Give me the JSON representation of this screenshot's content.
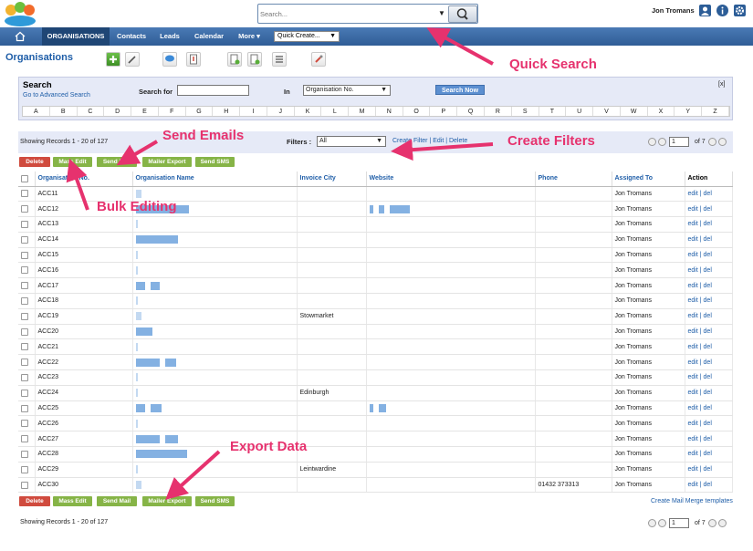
{
  "header": {
    "search_placeholder": "Search...",
    "user_name": "Jon Tromans",
    "icons": [
      "user-icon",
      "info-icon",
      "gear-icon"
    ]
  },
  "nav": {
    "home_icon": "home-icon",
    "tabs": [
      {
        "label": "ORGANISATIONS",
        "active": true
      },
      {
        "label": "Contacts"
      },
      {
        "label": "Leads"
      },
      {
        "label": "Calendar"
      },
      {
        "label": "More ▾"
      }
    ],
    "quick_create": "Quick Create..."
  },
  "page": {
    "title": "Organisations",
    "toolbar_icons": [
      "add-icon",
      "edit-icon",
      "chat-icon",
      "import-icon",
      "export-icon",
      "export-alt-icon",
      "merge-icon",
      "tools-icon"
    ]
  },
  "search": {
    "title": "Search",
    "advanced_link": "Go to Advanced Search",
    "search_for_label": "Search for",
    "in_label": "In",
    "in_value": "Organisation No.",
    "search_now": "Search Now",
    "close": "[x]",
    "alphabet": [
      "A",
      "B",
      "C",
      "D",
      "E",
      "F",
      "G",
      "H",
      "I",
      "J",
      "K",
      "L",
      "M",
      "N",
      "O",
      "P",
      "Q",
      "R",
      "S",
      "T",
      "U",
      "V",
      "W",
      "X",
      "Y",
      "Z"
    ]
  },
  "listing": {
    "showing_text": "Showing Records 1 - 20 of 127",
    "filters_label": "Filters :",
    "filter_value": "All",
    "filter_links": "Create Filter | Edit | Delete",
    "page_value": "1",
    "page_of": "of 7",
    "buttons": {
      "delete": "Delete",
      "mass_edit": "Mass Edit",
      "send_mail": "Send Mail",
      "mailer_export": "Mailer Export",
      "send_sms": "Send SMS"
    },
    "create_mail_merge": "Create Mail Merge templates"
  },
  "table": {
    "columns": [
      "Organisation No.",
      "Organisation Name",
      "Invoice City",
      "Website",
      "Phone",
      "Assigned To",
      "Action"
    ],
    "rows": [
      {
        "no": "ACC11",
        "city": "",
        "phone": "",
        "assigned": "Jon Tromans"
      },
      {
        "no": "ACC12",
        "city": "",
        "phone": "",
        "assigned": "Jon Tromans"
      },
      {
        "no": "ACC13",
        "city": "",
        "phone": "",
        "assigned": "Jon Tromans"
      },
      {
        "no": "ACC14",
        "city": "",
        "phone": "",
        "assigned": "Jon Tromans"
      },
      {
        "no": "ACC15",
        "city": "",
        "phone": "",
        "assigned": "Jon Tromans"
      },
      {
        "no": "ACC16",
        "city": "",
        "phone": "",
        "assigned": "Jon Tromans"
      },
      {
        "no": "ACC17",
        "city": "",
        "phone": "",
        "assigned": "Jon Tromans"
      },
      {
        "no": "ACC18",
        "city": "",
        "phone": "",
        "assigned": "Jon Tromans"
      },
      {
        "no": "ACC19",
        "city": "Stowmarket",
        "phone": "",
        "assigned": "Jon Tromans"
      },
      {
        "no": "ACC20",
        "city": "",
        "phone": "",
        "assigned": "Jon Tromans"
      },
      {
        "no": "ACC21",
        "city": "",
        "phone": "",
        "assigned": "Jon Tromans"
      },
      {
        "no": "ACC22",
        "city": "",
        "phone": "",
        "assigned": "Jon Tromans"
      },
      {
        "no": "ACC23",
        "city": "",
        "phone": "",
        "assigned": "Jon Tromans"
      },
      {
        "no": "ACC24",
        "city": "Edinburgh",
        "phone": "",
        "assigned": "Jon Tromans"
      },
      {
        "no": "ACC25",
        "city": "",
        "phone": "",
        "assigned": "Jon Tromans"
      },
      {
        "no": "ACC26",
        "city": "",
        "phone": "",
        "assigned": "Jon Tromans"
      },
      {
        "no": "ACC27",
        "city": "",
        "phone": "",
        "assigned": "Jon Tromans"
      },
      {
        "no": "ACC28",
        "city": "",
        "phone": "",
        "assigned": "Jon Tromans"
      },
      {
        "no": "ACC29",
        "city": "Leintwardine",
        "phone": "",
        "assigned": "Jon Tromans"
      },
      {
        "no": "ACC30",
        "city": "",
        "phone": "01432 373313",
        "assigned": "Jon Tromans"
      }
    ],
    "action_edit": "edit",
    "action_sep": "|",
    "action_del": "del"
  },
  "annotations": {
    "quick_search": "Quick Search",
    "send_emails": "Send Emails",
    "create_filters": "Create Filters",
    "bulk_editing": "Bulk Editing",
    "export_data": "Export Data",
    "color": "#e6326e"
  }
}
